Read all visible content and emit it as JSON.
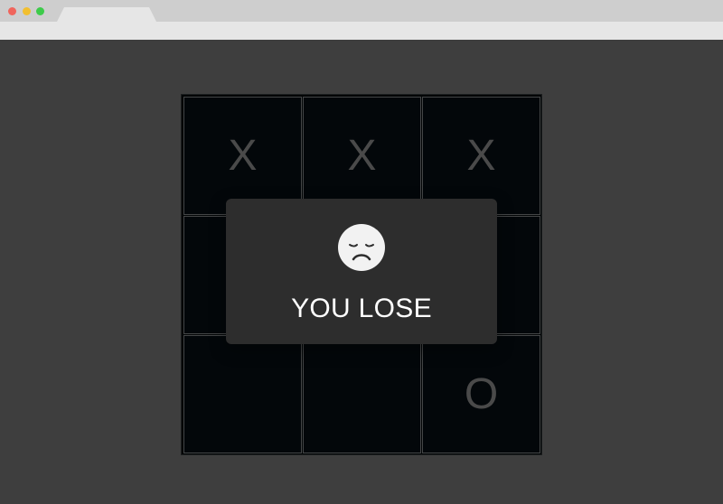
{
  "window": {
    "tab_title": ""
  },
  "board": {
    "cells": [
      "X",
      "X",
      "X",
      "",
      "",
      "",
      "",
      "",
      "O"
    ]
  },
  "modal": {
    "icon": "sad-face-icon",
    "message": "YOU LOSE"
  },
  "colors": {
    "page_background": "#3e3e3e",
    "board_background": "#03070a",
    "grid_line": "#444647",
    "mark_color": "#4a4a4a",
    "modal_background": "#2d2d2d",
    "text_color": "#ffffff"
  }
}
